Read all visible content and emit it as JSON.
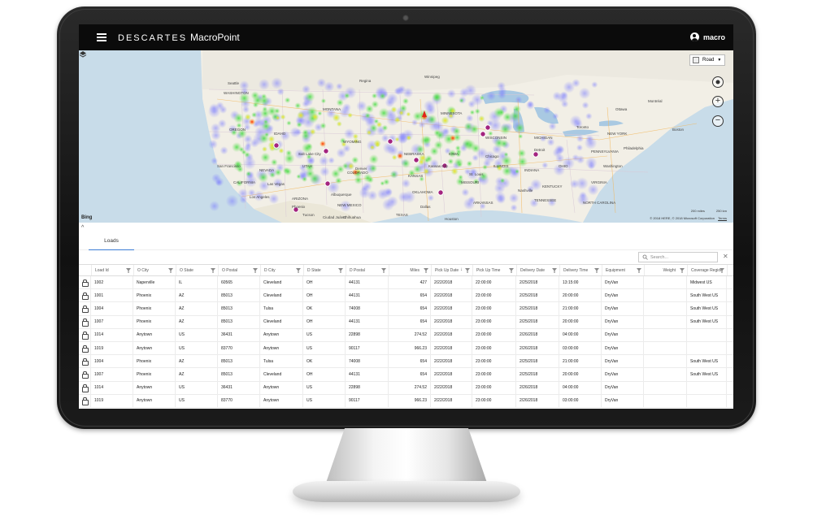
{
  "app": {
    "brand": "DESCARTES",
    "product": "MacroPoint",
    "user": "macro"
  },
  "map": {
    "style_label": "Road",
    "provider": "Bing",
    "scale_miles": "200 miles",
    "scale_km": "250 km",
    "copyright": "© 2018 HERE, © 2018 Microsoft Corporation",
    "terms": "Terms",
    "labels": [
      "Seattle",
      "WASHINGTON",
      "OREGON",
      "IDAHO",
      "MONTANA",
      "WYOMING",
      "NEVADA",
      "UTAH",
      "CALIFORNIA",
      "ARIZONA",
      "NEW MEXICO",
      "COLORADO",
      "NEBRASKA",
      "KANSAS",
      "OKLAHOMA",
      "TEXAS",
      "MINNESOTA",
      "IOWA",
      "MISSOURI",
      "ARKANSAS",
      "WISCONSIN",
      "ILLINOIS",
      "MICHIGAN",
      "INDIANA",
      "OHIO",
      "KENTUCKY",
      "TENNESSEE",
      "PENNSYLVANIA",
      "NEW YORK",
      "VIRGINIA",
      "NORTH CAROLINA",
      "Toronto",
      "Ottawa",
      "Montréal",
      "Chicago",
      "Detroit",
      "Denver",
      "Dallas",
      "Houston",
      "Los Angeles",
      "Phoenix",
      "Las Vegas",
      "San Francisco",
      "Salt Lake City",
      "Kansas City",
      "St. Louis",
      "Nashville",
      "Washington",
      "Boston",
      "Philadelphia",
      "Ciudad Juárez",
      "Chihuahua",
      "Tucson",
      "Albuquerque",
      "Winnipeg",
      "Regina"
    ]
  },
  "tabs": {
    "loads": "Loads"
  },
  "search": {
    "placeholder": "Search..."
  },
  "grid": {
    "columns": [
      "Load Id",
      "O City",
      "O State",
      "O Postal",
      "D City",
      "D State",
      "D Postal",
      "Miles",
      "Pick Up Date",
      "Pick Up Time",
      "Delivery Date",
      "Delivery Time",
      "Equipment",
      "Weight",
      "Coverage Region"
    ],
    "rows": [
      [
        "1002",
        "Naperville",
        "IL",
        "60565",
        "Cleveland",
        "OH",
        "44131",
        "427",
        "2/22/2018",
        "22:00:00",
        "2/25/2018",
        "13:15:00",
        "DryVan",
        "",
        "Midwest US"
      ],
      [
        "1001",
        "Phoenix",
        "AZ",
        "85013",
        "Cleveland",
        "OH",
        "44131",
        "654",
        "2/22/2018",
        "23:00:00",
        "2/25/2018",
        "20:00:00",
        "DryVan",
        "",
        "South West US"
      ],
      [
        "1004",
        "Phoenix",
        "AZ",
        "85013",
        "Tulsa",
        "OK",
        "74008",
        "654",
        "2/22/2018",
        "23:00:00",
        "2/25/2018",
        "21:00:00",
        "DryVan",
        "",
        "South West US"
      ],
      [
        "1007",
        "Phoenix",
        "AZ",
        "85013",
        "Cleveland",
        "OH",
        "44131",
        "654",
        "2/22/2018",
        "23:00:00",
        "2/25/2018",
        "20:00:00",
        "DryVan",
        "",
        "South West US"
      ],
      [
        "1014",
        "Anytown",
        "US",
        "36431",
        "Anytown",
        "US",
        "22898",
        "274.52",
        "2/22/2018",
        "23:00:00",
        "2/26/2018",
        "04:00:00",
        "DryVan",
        "",
        ""
      ],
      [
        "1019",
        "Anytown",
        "US",
        "83770",
        "Anytown",
        "US",
        "90117",
        "966.23",
        "2/22/2018",
        "23:00:00",
        "2/26/2018",
        "03:00:00",
        "DryVan",
        "",
        ""
      ],
      [
        "1004",
        "Phoenix",
        "AZ",
        "85013",
        "Tulsa",
        "OK",
        "74008",
        "654",
        "2/22/2018",
        "23:00:00",
        "2/25/2018",
        "21:00:00",
        "DryVan",
        "",
        "South West US"
      ],
      [
        "1007",
        "Phoenix",
        "AZ",
        "85013",
        "Cleveland",
        "OH",
        "44131",
        "654",
        "2/22/2018",
        "23:00:00",
        "2/25/2018",
        "20:00:00",
        "DryVan",
        "",
        "South West US"
      ],
      [
        "1014",
        "Anytown",
        "US",
        "36431",
        "Anytown",
        "US",
        "22898",
        "274.52",
        "2/22/2018",
        "23:00:00",
        "2/26/2018",
        "04:00:00",
        "DryVan",
        "",
        ""
      ],
      [
        "1019",
        "Anytown",
        "US",
        "83770",
        "Anytown",
        "US",
        "90117",
        "966.23",
        "2/22/2018",
        "23:00:00",
        "2/26/2018",
        "03:00:00",
        "DryVan",
        "",
        ""
      ]
    ]
  }
}
